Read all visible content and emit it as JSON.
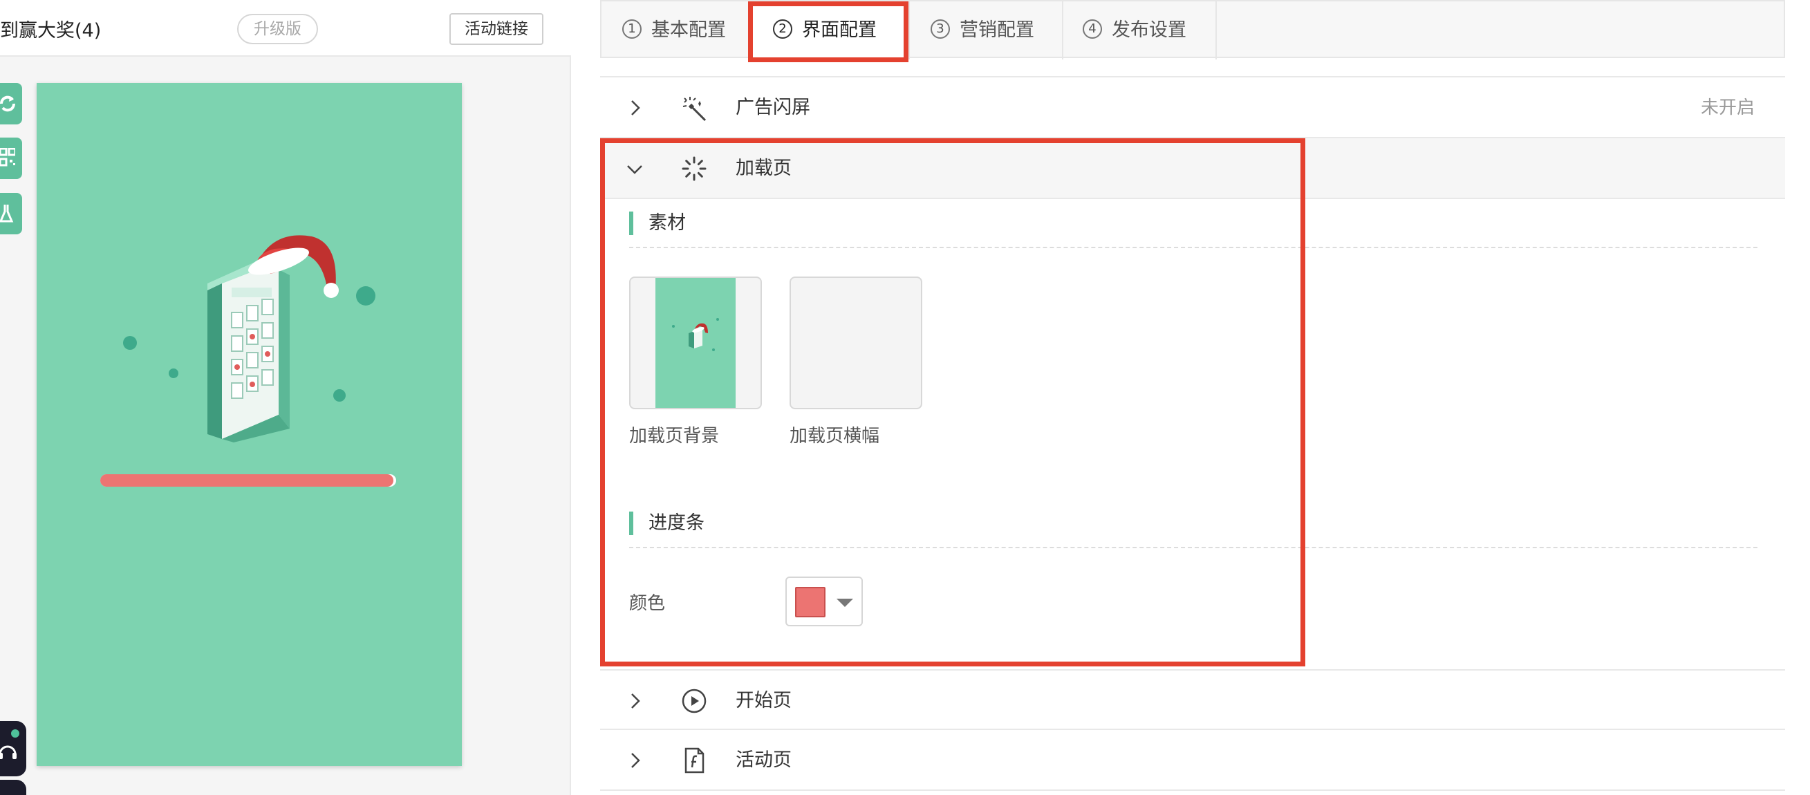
{
  "left": {
    "title": "到赢大奖(4)",
    "upgrade_badge": "升级版",
    "link_button": "活动链接",
    "preview": {
      "progress_fraction": 0.99,
      "progress_color": "#EC7472",
      "background_color": "#7DD3B0"
    }
  },
  "tabs": [
    {
      "num": "1",
      "label": "基本配置"
    },
    {
      "num": "2",
      "label": "界面配置"
    },
    {
      "num": "3",
      "label": "营销配置"
    },
    {
      "num": "4",
      "label": "发布设置"
    }
  ],
  "sections": {
    "splash": {
      "label": "广告闪屏",
      "status": "未开启",
      "icon": "magic-wand-icon"
    },
    "loading": {
      "label": "加载页",
      "icon": "spinner-icon"
    },
    "start": {
      "label": "开始页",
      "icon": "play-circle-icon"
    },
    "activity": {
      "label": "活动页",
      "icon": "document-icon"
    }
  },
  "loading_page": {
    "material_heading": "素材",
    "materials": [
      {
        "label": "加载页背景"
      },
      {
        "label": "加载页横幅"
      }
    ],
    "progress_heading": "进度条",
    "color_label": "颜色",
    "color_value": "#EC7472"
  },
  "colors": {
    "accent": "#5FBF9C",
    "highlight": "#E4412F"
  }
}
